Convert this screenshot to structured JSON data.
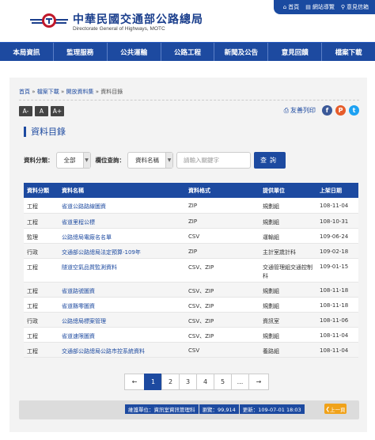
{
  "header": {
    "title": "中華民國交通部公路總局",
    "subtitle": "Directorate General of Highways, MOTC",
    "top_links": [
      {
        "icon": "home-icon",
        "label": "首頁"
      },
      {
        "icon": "sitemap-icon",
        "label": "網站導覽"
      },
      {
        "icon": "search-icon",
        "label": "意見信箱"
      }
    ]
  },
  "nav": [
    "本局資訊",
    "監理服務",
    "公共運輸",
    "公路工程",
    "新聞及公告",
    "意見回饋",
    "檔案下載"
  ],
  "breadcrumb": [
    "首頁",
    "檔案下載",
    "開放資料集",
    "資料目錄"
  ],
  "font_sizes": [
    "A-",
    "A",
    "A+"
  ],
  "tools": {
    "print_label": "友善列印"
  },
  "page_title": "資料目錄",
  "filter": {
    "category_label": "資料分類：",
    "category_value": "全部",
    "field_label": "欄位查詢：",
    "field_value": "資料名稱",
    "keyword_placeholder": "請輸入關鍵字",
    "search_label": "查詢"
  },
  "table": {
    "columns": [
      "資料分類",
      "資料名稱",
      "資料格式",
      "提供單位",
      "上架日期"
    ],
    "rows": [
      [
        "工程",
        "省道公路路線圖資",
        "ZIP",
        "規劃組",
        "108-11-04"
      ],
      [
        "工程",
        "省道里程公標",
        "ZIP",
        "規劃組",
        "108-10-31"
      ],
      [
        "監理",
        "公路總局電廠名名單",
        "CSV",
        "運輸組",
        "109-06-24"
      ],
      [
        "行政",
        "交通部公路總局法定預算-109年",
        "ZIP",
        "主計室歲計科",
        "109-02-18"
      ],
      [
        "工程",
        "隧道空氣品質監測資料",
        "CSV、ZIP",
        "交通管理組交通控制科",
        "109-01-15"
      ],
      [
        "工程",
        "省道路號圖資",
        "CSV、ZIP",
        "規劃組",
        "108-11-18"
      ],
      [
        "工程",
        "省道縣零圖資",
        "CSV、ZIP",
        "規劃組",
        "108-11-18"
      ],
      [
        "行政",
        "公路總局標案管理",
        "CSV、ZIP",
        "資訊室",
        "108-11-06"
      ],
      [
        "工程",
        "省道速限圖資",
        "CSV、ZIP",
        "規劃組",
        "108-11-04"
      ],
      [
        "工程",
        "交通部公路總局公路市控系統資料",
        "CSV",
        "養路組",
        "108-11-04"
      ]
    ]
  },
  "pager": [
    "←",
    "1",
    "2",
    "3",
    "4",
    "5",
    "...",
    "→"
  ],
  "footer": {
    "owner": "維護單位：資訊室資訊管理科",
    "views": "瀏覽：99,914",
    "updated": "更新：109-07-01 18:03",
    "top_label": "上一頁"
  },
  "colors": {
    "brand": "#1d4aa0",
    "accent": "#f0a21a"
  }
}
